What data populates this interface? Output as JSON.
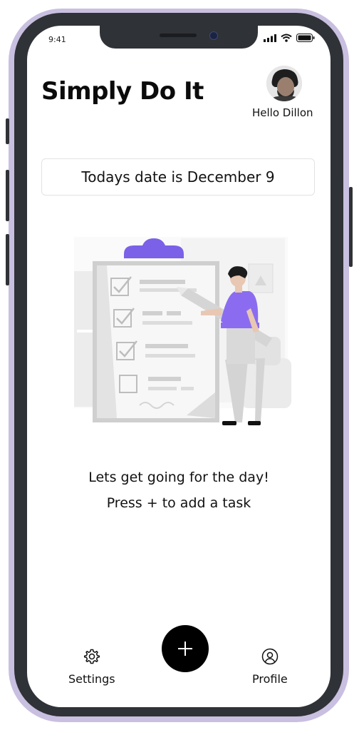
{
  "status_bar": {
    "time": "9:41"
  },
  "header": {
    "app_title": "Simply Do It",
    "greeting": "Hello Dillon"
  },
  "date_card": {
    "text": "Todays date is December 9"
  },
  "empty_state": {
    "line1": "Lets get going for the day!",
    "line2": "Press + to add a task"
  },
  "bottom_nav": {
    "settings_label": "Settings",
    "add_button_symbol": "+",
    "profile_label": "Profile"
  },
  "icons": {
    "settings": "gear-icon",
    "profile": "user-circle-icon",
    "add": "plus-icon"
  },
  "colors": {
    "accent": "#7B61E8",
    "frame": "#C9BFE0",
    "fab": "#000000"
  }
}
